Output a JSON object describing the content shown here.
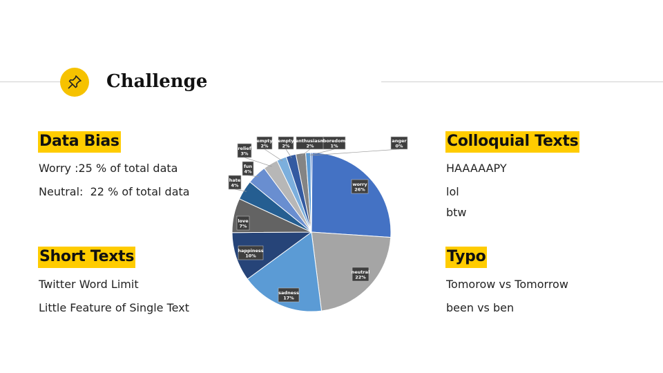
{
  "title": "Challenge",
  "icon": "pushpin-icon",
  "accent_color": "#ffcc00",
  "sections": {
    "data_bias": {
      "heading": "Data Bias",
      "lines": [
        "Worry :25 % of total data",
        "Neutral:  22 % of total data"
      ]
    },
    "short_texts": {
      "heading": "Short Texts",
      "lines": [
        "Twitter Word Limit",
        "Little Feature of Single Text"
      ]
    },
    "colloquial": {
      "heading": "Colloquial Texts",
      "lines": [
        "HAAAAAPY",
        "lol",
        "btw"
      ]
    },
    "typo": {
      "heading": "Typo",
      "lines": [
        "Tomorow vs Tomorrow",
        "been vs ben"
      ]
    }
  },
  "chart_data": {
    "type": "pie",
    "slices": [
      {
        "label": "worry",
        "value": 26,
        "display": "26%",
        "color": "#4472c4"
      },
      {
        "label": "neutral",
        "value": 22,
        "display": "22%",
        "color": "#a5a5a5"
      },
      {
        "label": "sadness",
        "value": 17,
        "display": "17%",
        "color": "#5b9bd5"
      },
      {
        "label": "happiness",
        "value": 10,
        "display": "10%",
        "color": "#264478"
      },
      {
        "label": "love",
        "value": 7,
        "display": "7%",
        "color": "#636363"
      },
      {
        "label": "hate",
        "value": 4,
        "display": "4%",
        "color": "#255e91"
      },
      {
        "label": "fun",
        "value": 4,
        "display": "4%",
        "color": "#698ed0"
      },
      {
        "label": "relief",
        "value": 3,
        "display": "3%",
        "color": "#b7b7b7"
      },
      {
        "label": "empty",
        "value": 2,
        "display": "2%",
        "color": "#7cafdd"
      },
      {
        "label": "empty",
        "value": 2,
        "display": "2%",
        "color": "#335aa1"
      },
      {
        "label": "enthusiasm",
        "value": 2,
        "display": "2%",
        "color": "#848484"
      },
      {
        "label": "boredom",
        "value": 1,
        "display": "1%",
        "color": "#5b9bd5"
      },
      {
        "label": "anger",
        "value": 0.3,
        "display": "0%",
        "color": "#4472c4"
      }
    ]
  }
}
